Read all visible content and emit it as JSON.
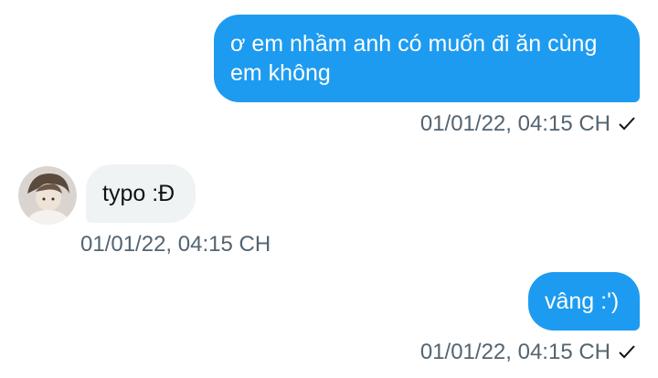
{
  "messages": [
    {
      "direction": "outgoing",
      "text": "ơ em nhầm anh có muốn đi ăn cùng em không",
      "timestamp": "01/01/22, 04:15 CH",
      "status_icon": "check-icon"
    },
    {
      "direction": "incoming",
      "text": "typo :Đ",
      "timestamp": "01/01/22, 04:15 CH",
      "avatar_icon": "user-avatar"
    },
    {
      "direction": "outgoing",
      "text": "vâng :')",
      "timestamp": "01/01/22, 04:15 CH",
      "status_icon": "check-icon"
    }
  ],
  "colors": {
    "outgoing_bubble": "#1d9bf0",
    "incoming_bubble": "#eff3f4",
    "meta_text": "#536471"
  }
}
